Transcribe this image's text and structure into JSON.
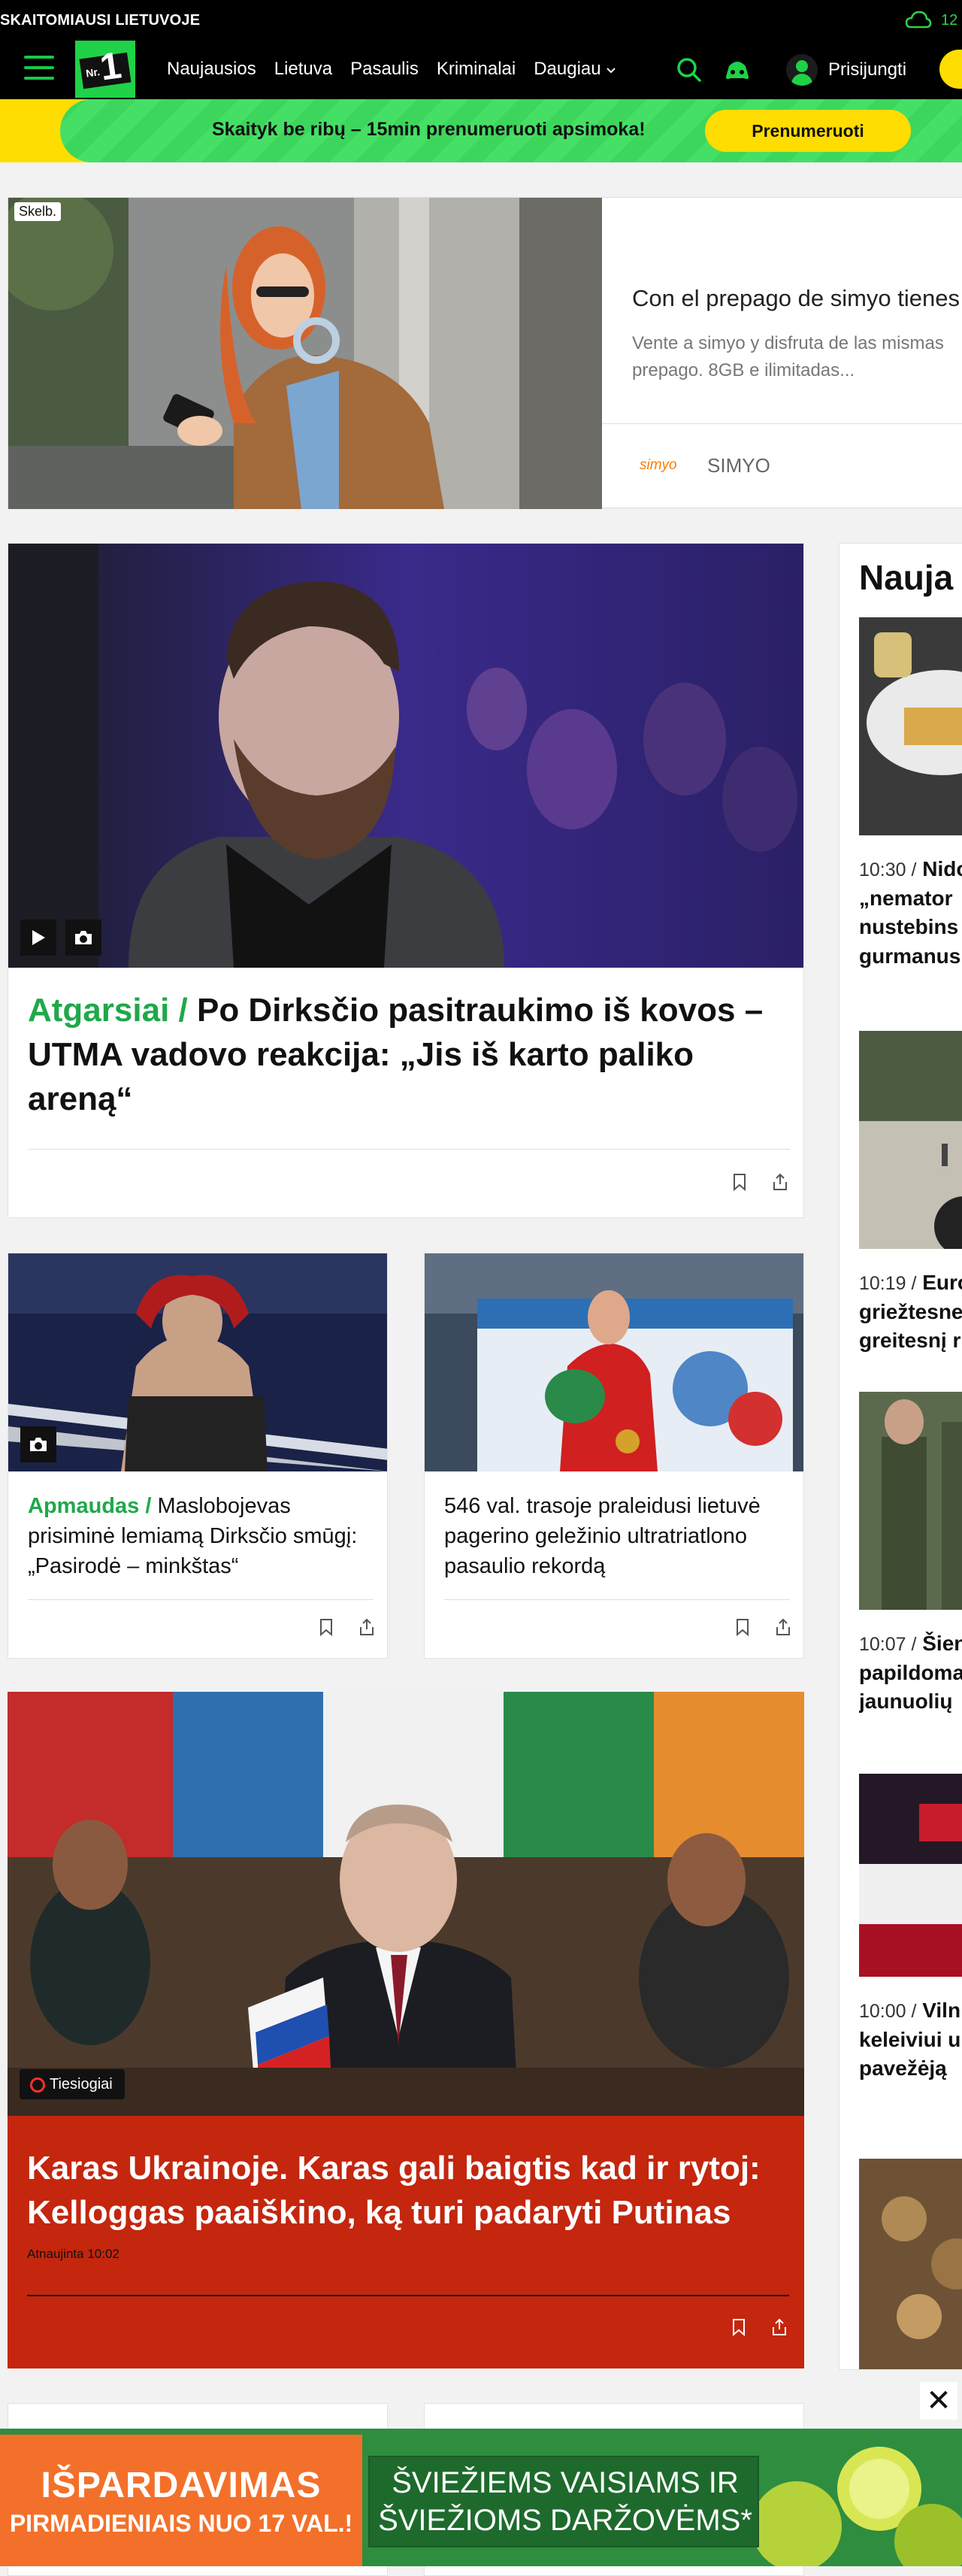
{
  "topbar": {
    "tagline": "SKAITOMIAUSI LIETUVOJE",
    "temperature": "12"
  },
  "nav": {
    "logo_text": "Nr.",
    "logo_number": "1",
    "links": [
      "Naujausios",
      "Lietuva",
      "Pasaulis",
      "Kriminalai",
      "Daugiau"
    ],
    "login_label": "Prisijungti"
  },
  "promo": {
    "text": "Skaityk be ribų – 15min prenumeruoti apsimoka!",
    "button": "Prenumeruoti"
  },
  "ad": {
    "label": "Skelb.",
    "title": "Con el prepago de simyo tienes",
    "description_line1": "Vente a simyo y disfruta de las mismas",
    "description_line2": "prepago. 8GB e ilimitadas...",
    "brand_logo": "simyo",
    "brand_name": "SIMYO"
  },
  "main_story": {
    "kicker": "Atgarsiai /",
    "headline": "Po Dirksčio pasitraukimo iš kovos – UTMA vadovo reakcija: „Jis iš karto paliko areną“"
  },
  "story_left": {
    "kicker": "Apmaudas /",
    "headline": "Maslobojevas prisiminė lemiamą Dirksčio smūgį: „Pasirodė – minkštas“"
  },
  "story_right": {
    "headline": "546 val. trasoje praleidusi lietuvė pagerino geležinio ultratriatlono pasaulio rekordą"
  },
  "live_story": {
    "badge": "Tiesiogiai",
    "headline": "Karas Ukrainoje. Karas gali baigtis kad ir rytoj: Kelloggas paaiškino, ką turi padaryti Putinas",
    "updated": "Atnaujinta 10:02"
  },
  "sidebar": {
    "title": "Nauja",
    "items": [
      {
        "time": "10:30 /",
        "lines": [
          "Nido",
          "„nemator",
          "nustebins",
          "gurmanus"
        ]
      },
      {
        "time": "10:19 /",
        "lines": [
          "Euro",
          "griežtesne",
          "greitesnį r"
        ]
      },
      {
        "time": "10:07 /",
        "lines": [
          "Šien",
          "papildoma",
          "jaunuolių"
        ]
      },
      {
        "time": "10:00 /",
        "lines": [
          "Vilni",
          "keleiviui u",
          "pavežėją"
        ]
      }
    ]
  },
  "bottom_ad": {
    "left_line1": "IŠPARDAVIMAS",
    "left_line2": "PIRMADIENIAIS NUO 17 VAL.!",
    "right_line1": "ŠVIEŽIEMS VAISIAMS IR",
    "right_line2": "ŠVIEŽIOMS DARŽOVĖMS*",
    "close": "✕"
  }
}
